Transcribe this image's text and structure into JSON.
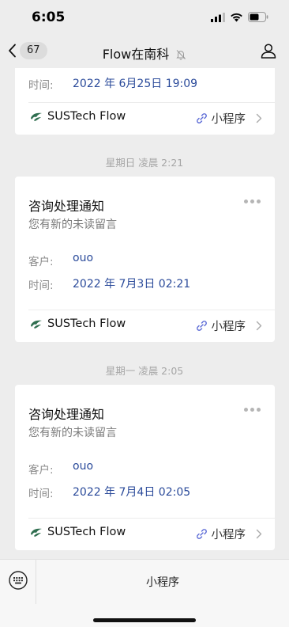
{
  "status_bar": {
    "time": "6:05"
  },
  "nav": {
    "back_count": "67",
    "title": "Flow在南科"
  },
  "top_card": {
    "time_label": "时间:",
    "time_value": "2022 年 6月25日 19:09",
    "brand": "SUSTech Flow",
    "mini_label": "小程序"
  },
  "messages": [
    {
      "timestamp": "星期日 凌晨 2:21",
      "title": "咨询处理通知",
      "subtitle": "您有新的未读留言",
      "customer_label": "客户:",
      "customer_value": "ouo",
      "time_label": "时间:",
      "time_value": "2022 年 7月3日 02:21",
      "brand": "SUSTech Flow",
      "mini_label": "小程序"
    },
    {
      "timestamp": "星期一 凌晨 2:05",
      "title": "咨询处理通知",
      "subtitle": "您有新的未读留言",
      "customer_label": "客户:",
      "customer_value": "ouo",
      "time_label": "时间:",
      "time_value": "2022 年 7月4日 02:05",
      "brand": "SUSTech Flow",
      "mini_label": "小程序"
    }
  ],
  "bottom_bar": {
    "label": "小程序"
  },
  "icons": {
    "back": "chevron-left-icon",
    "mute": "bell-off-icon",
    "profile": "person-icon",
    "more": "more-dots-icon",
    "brand": "sustech-flow-logo-icon",
    "link": "link-icon",
    "chevron": "chevron-right-icon",
    "keyboard": "keyboard-icon"
  },
  "colors": {
    "background": "#ededed",
    "link_blue": "#2a4a9a",
    "muted": "#8a8a8a"
  }
}
